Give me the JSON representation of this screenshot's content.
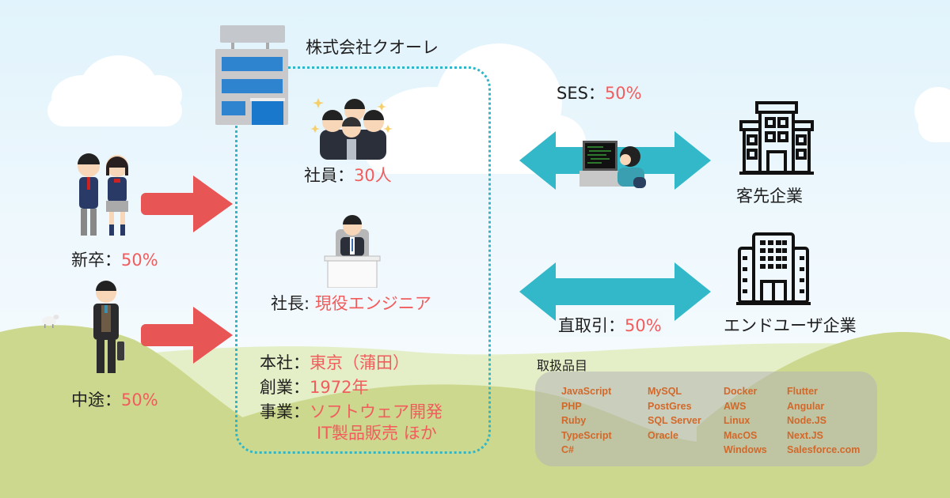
{
  "company": {
    "name": "株式会社クオーレ",
    "employees_label": "社員：",
    "employees_value": "30人",
    "president_label": "社長: ",
    "president_value": "現役エンジニア",
    "hq_label": "本社：",
    "hq_value": "東京（蒲田）",
    "founded_label": "創業：",
    "founded_value": "1972年",
    "business_label": "事業：",
    "business_value_line1": "ソフトウェア開発",
    "business_value_line2": "IT製品販売 ほか"
  },
  "hiring": {
    "new_grad_label": "新卒：",
    "new_grad_value": "50%",
    "mid_career_label": "中途：",
    "mid_career_value": "50%"
  },
  "channels": {
    "ses_label": "SES：",
    "ses_value": "50%",
    "ses_target": "客先企業",
    "direct_label": "直取引：",
    "direct_value": "50%",
    "direct_target": "エンドユーザ企業"
  },
  "products": {
    "title": "取扱品目",
    "columns": [
      [
        "JavaScript",
        "PHP",
        "Ruby",
        "TypeScript",
        "C#"
      ],
      [
        "MySQL",
        "PostGres",
        "SQL Server",
        "Oracle"
      ],
      [
        "Docker",
        "AWS",
        "Linux",
        "MacOS",
        "Windows"
      ],
      [
        "Flutter",
        "Angular",
        "Node.JS",
        "Next.JS",
        "Salesforce.com"
      ]
    ]
  },
  "colors": {
    "accent_red": "#f25c5c",
    "arrow_red": "#e85555",
    "arrow_teal": "#33b8c9",
    "product_orange": "#d2682a",
    "hill_green": "#ccd88e"
  }
}
